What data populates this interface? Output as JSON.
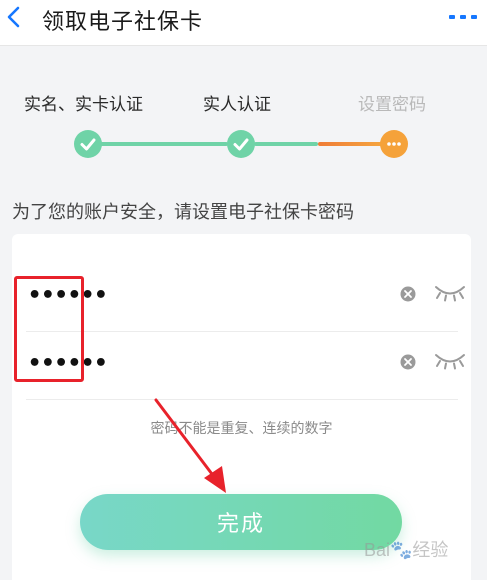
{
  "nav": {
    "title": "领取电子社保卡",
    "back_icon": "chevron-left-icon",
    "more_icon": "more-dots-icon",
    "accent_color": "#1677ff"
  },
  "steps": [
    {
      "label": "实名、实卡认证",
      "status": "done"
    },
    {
      "label": "实人认证",
      "status": "done"
    },
    {
      "label": "设置密码",
      "status": "current"
    }
  ],
  "instruction": "为了您的账户安全，请设置电子社保卡密码",
  "form": {
    "password_value": "••••••",
    "confirm_value": "••••••",
    "hint": "密码不能是重复、连续的数字"
  },
  "submit_label": "完成",
  "colors": {
    "done_green": "#6fd3a7",
    "current_orange": "#f5a23a",
    "highlight_red": "#e8222b"
  },
  "watermark": "Bai🐾经验"
}
